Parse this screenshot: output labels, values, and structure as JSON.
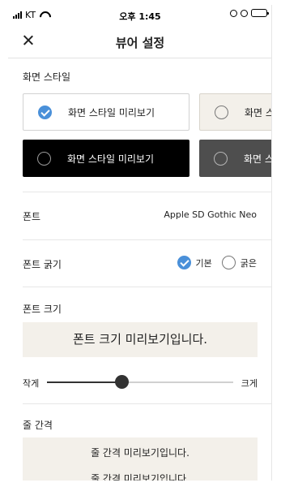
{
  "status_bar": {
    "carrier": "KT",
    "time": "오후 1:45"
  },
  "header": {
    "title": "뷰어 설정"
  },
  "screen_style": {
    "label": "화면 스타일",
    "options": [
      {
        "label": "화면 스타일 미리보기",
        "theme": "white",
        "selected": true
      },
      {
        "label": "화면 스",
        "theme": "beige",
        "selected": false
      },
      {
        "label": "화면 스타일 미리보기",
        "theme": "black",
        "selected": false
      },
      {
        "label": "화면 스",
        "theme": "gray",
        "selected": false
      }
    ]
  },
  "font": {
    "label": "폰트",
    "value": "Apple SD Gothic Neo"
  },
  "font_weight": {
    "label": "폰트 굵기",
    "options": [
      {
        "label": "기본",
        "selected": true
      },
      {
        "label": "굵은",
        "selected": false
      }
    ]
  },
  "font_size": {
    "label": "폰트 크기",
    "preview": "폰트 크기 미리보기입니다.",
    "min_label": "작게",
    "max_label": "크게",
    "level": 0.4
  },
  "line_spacing": {
    "label": "줄 간격",
    "preview_lines": [
      "줄 간격 미리보기입니다.",
      "줄 간격 미리보기입니다."
    ]
  },
  "colors": {
    "accent": "#4a90d9",
    "beige": "#f3f0ea",
    "dark_gray": "#4e4e4e"
  }
}
